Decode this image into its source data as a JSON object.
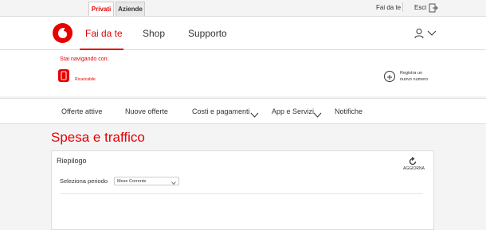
{
  "topbar": {
    "tabs": [
      {
        "label": "Privati"
      },
      {
        "label": "Aziende"
      }
    ],
    "fai_da_te": "Fai da te",
    "esci": "Esci"
  },
  "mainnav": {
    "items": [
      {
        "label": "Fai da te"
      },
      {
        "label": "Shop"
      },
      {
        "label": "Supporto"
      }
    ]
  },
  "infobar": {
    "navigating_label": "Stai navigando con:",
    "line_type": "Ricaricabile",
    "register_line1": "Registra un",
    "register_line2": "nuovo numero"
  },
  "secnav": {
    "items": [
      {
        "label": "Offerte attive"
      },
      {
        "label": "Nuove offerte"
      },
      {
        "label": "Costi e pagamenti"
      },
      {
        "label": "App e Servizi"
      },
      {
        "label": "Notifiche"
      }
    ]
  },
  "page": {
    "title": "Spesa e traffico"
  },
  "card": {
    "title": "Riepilogo",
    "refresh_label": "AGGIORNA",
    "period_label": "Seleziona periodo",
    "period_value": "Mese Corrente"
  },
  "colors": {
    "brand": "#e60000"
  }
}
